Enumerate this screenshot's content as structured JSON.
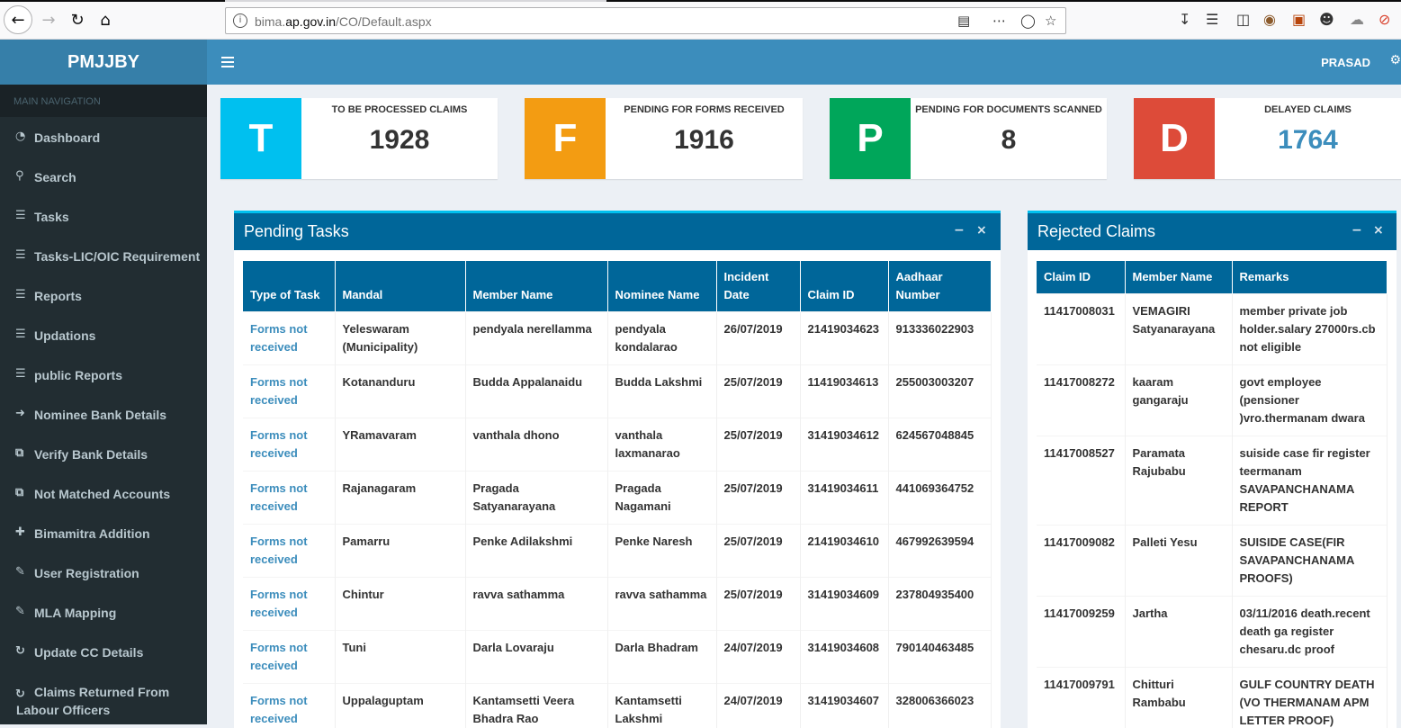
{
  "browser": {
    "url_prefix": "bima.",
    "url_domain": "ap.gov.in",
    "url_path": "/CO/Default.aspx"
  },
  "app": {
    "title": "PMJJBY",
    "user": "PRASAD"
  },
  "sidebar": {
    "header": "MAIN NAVIGATION",
    "items": [
      {
        "label": "Dashboard",
        "icon": "dashboard-icon"
      },
      {
        "label": "Search",
        "icon": "search-icon"
      },
      {
        "label": "Tasks",
        "icon": "list-icon"
      },
      {
        "label": "Tasks-LIC/OIC Requirement",
        "icon": "list-icon"
      },
      {
        "label": "Reports",
        "icon": "list-icon"
      },
      {
        "label": "Updations",
        "icon": "list-icon"
      },
      {
        "label": "public Reports",
        "icon": "list-icon"
      },
      {
        "label": "Nominee Bank Details",
        "icon": "sign-in-icon"
      },
      {
        "label": "Verify Bank Details",
        "icon": "external-link-icon"
      },
      {
        "label": "Not Matched Accounts",
        "icon": "external-link-icon"
      },
      {
        "label": "Bimamitra Addition",
        "icon": "plus-icon"
      },
      {
        "label": "User Registration",
        "icon": "pencil-icon"
      },
      {
        "label": "MLA Mapping",
        "icon": "pencil-icon"
      },
      {
        "label": "Update CC Details",
        "icon": "refresh-icon"
      },
      {
        "label": "Claims Returned From Labour Officers",
        "icon": "refresh-icon"
      }
    ]
  },
  "stats": [
    {
      "letter": "T",
      "label": "TO BE PROCESSED CLAIMS",
      "value": "1928",
      "color": "#00c0ef",
      "value_color": "#333333"
    },
    {
      "letter": "F",
      "label": "PENDING FOR FORMS RECEIVED",
      "value": "1916",
      "color": "#f39c12",
      "value_color": "#333333"
    },
    {
      "letter": "P",
      "label": "PENDING FOR DOCUMENTS SCANNED",
      "value": "8",
      "color": "#00a65a",
      "value_color": "#333333"
    },
    {
      "letter": "D",
      "label": "DELAYED CLAIMS",
      "value": "1764",
      "color": "#dd4b39",
      "value_color": "#3c8dbc"
    }
  ],
  "pending_tasks": {
    "title": "Pending Tasks",
    "columns": [
      "Type of Task",
      "Mandal",
      "Member Name",
      "Nominee Name",
      "Incident Date",
      "Claim ID",
      "Aadhaar Number"
    ],
    "rows": [
      [
        "Forms not received",
        "Yeleswaram (Municipality)",
        "pendyala nerellamma",
        "pendyala kondalarao",
        "26/07/2019",
        "21419034623",
        "913336022903"
      ],
      [
        "Forms not received",
        "Kotananduru",
        "Budda Appalanaidu",
        "Budda Lakshmi",
        "25/07/2019",
        "11419034613",
        "255003003207"
      ],
      [
        "Forms not received",
        "YRamavaram",
        "vanthala dhono",
        "vanthala laxmanarao",
        "25/07/2019",
        "31419034612",
        "624567048845"
      ],
      [
        "Forms not received",
        "Rajanagaram",
        "Pragada Satyanarayana",
        "Pragada Nagamani",
        "25/07/2019",
        "31419034611",
        "441069364752"
      ],
      [
        "Forms not received",
        "Pamarru",
        "Penke Adilakshmi",
        "Penke Naresh",
        "25/07/2019",
        "21419034610",
        "467992639594"
      ],
      [
        "Forms not received",
        "Chintur",
        "ravva sathamma",
        "ravva sathamma",
        "25/07/2019",
        "31419034609",
        "237804935400"
      ],
      [
        "Forms not received",
        "Tuni",
        "Darla Lovaraju",
        "Darla Bhadram",
        "24/07/2019",
        "31419034608",
        "790140463485"
      ],
      [
        "Forms not received",
        "Uppalaguptam",
        "Kantamsetti Veera Bhadra Rao",
        "Kantamsetti Lakshmi",
        "24/07/2019",
        "31419034607",
        "328006366023"
      ]
    ]
  },
  "rejected_claims": {
    "title": "Rejected Claims",
    "columns": [
      "Claim ID",
      "Member Name",
      "Remarks"
    ],
    "rows": [
      [
        "11417008031",
        "VEMAGIRI Satyanarayana",
        "member private job holder.salary 27000rs.cb not eligible"
      ],
      [
        "11417008272",
        "kaaram gangaraju",
        "govt employee (pensioner )vro.thermanam dwara"
      ],
      [
        "11417008527",
        "Paramata Rajubabu",
        "suiside case fir register teermanam SAVAPANCHANAMA REPORT"
      ],
      [
        "11417009082",
        "Palleti Yesu",
        "SUISIDE CASE(FIR SAVAPANCHANAMA PROOFS)"
      ],
      [
        "11417009259",
        "Jartha",
        "03/11/2016 death.recent death ga register chesaru.dc proof"
      ],
      [
        "11417009791",
        "Chitturi Rambabu",
        "GULF COUNTRY DEATH (VO THERMANAM APM LETTER PROOF)"
      ]
    ]
  }
}
